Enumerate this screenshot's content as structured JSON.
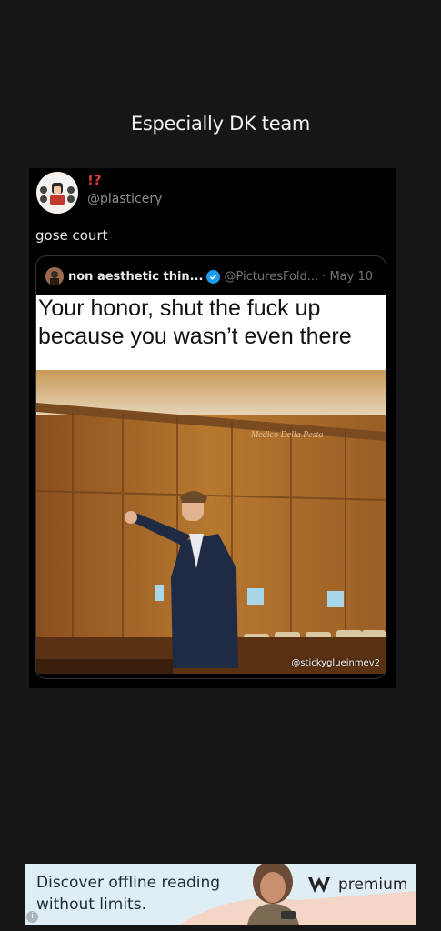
{
  "post": {
    "title": "Especially DK team"
  },
  "tweet": {
    "display_name": "!?",
    "handle": "@plasticery",
    "text": "gose court",
    "quote": {
      "name": "non aesthetic thin...",
      "handle": "@PicturesFold...",
      "date": "· May 10",
      "caption_line1": "Your honor, shut the fuck up",
      "caption_line2": "because you wasn’t even there",
      "watermark": "@stickyglueinmev2"
    }
  },
  "ad": {
    "line1": "Discover offline reading",
    "line2": "without limits.",
    "brand": "premium",
    "info": "i"
  }
}
